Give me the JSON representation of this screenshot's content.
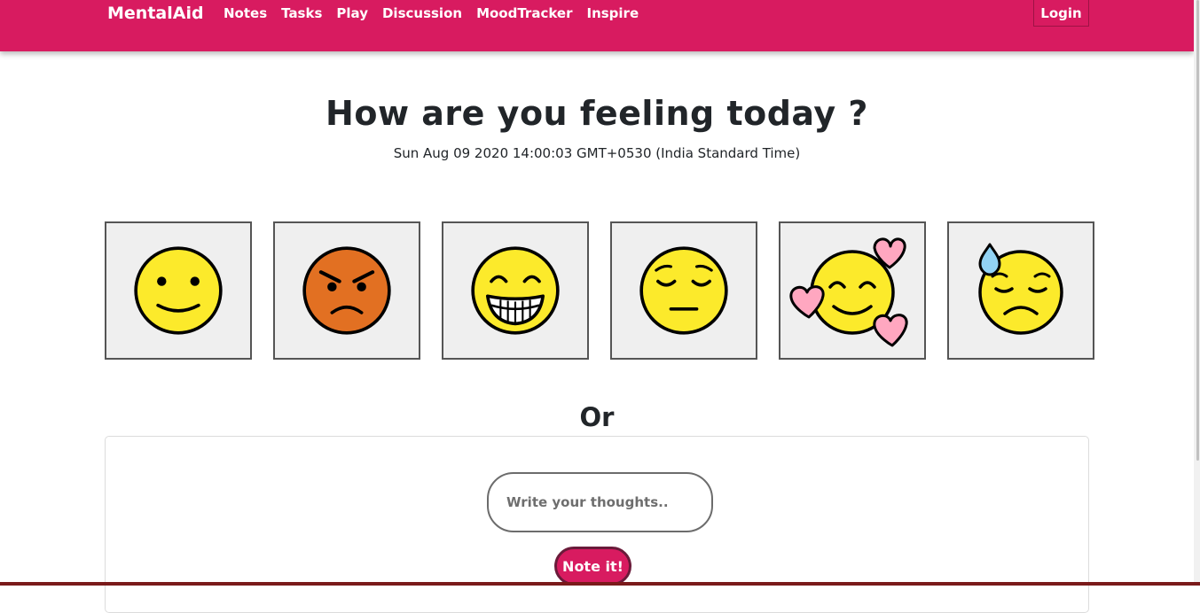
{
  "navbar": {
    "brand": "MentalAid",
    "links": [
      "Notes",
      "Tasks",
      "Play",
      "Discussion",
      "MoodTracker",
      "Inspire"
    ],
    "login": "Login",
    "color": "#d81b60"
  },
  "main": {
    "title": "How are you feeling today ?",
    "timestamp": "Sun Aug 09 2020 14:00:03 GMT+0530 (India Standard Time)",
    "moods": [
      {
        "icon": "slightly-smiling-face-icon"
      },
      {
        "icon": "angry-face-icon"
      },
      {
        "icon": "grinning-face-icon"
      },
      {
        "icon": "relieved-face-icon"
      },
      {
        "icon": "smiling-face-with-hearts-icon"
      },
      {
        "icon": "downcast-face-with-sweat-icon"
      }
    ],
    "or_label": "Or",
    "input_placeholder": "Write your thoughts..",
    "submit_label": "Note it!"
  }
}
